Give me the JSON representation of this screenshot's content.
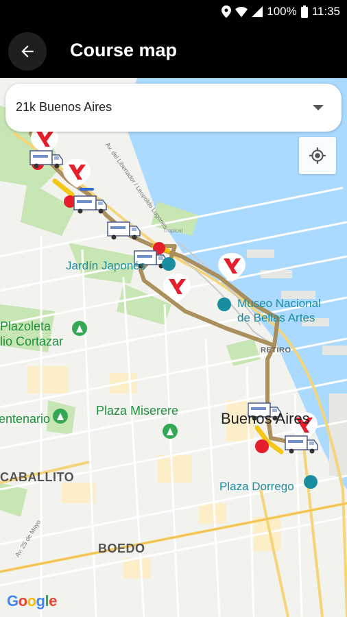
{
  "status_bar": {
    "battery": "100%",
    "time": "11:35"
  },
  "app_bar": {
    "title": "Course map"
  },
  "course_select": {
    "value": "21k Buenos Aires"
  },
  "map": {
    "places": {
      "jardin_japones": "Jardín Japonés",
      "museo": "Museo Nacional\nde Bellas Artes",
      "retiro": "RETIRO",
      "plazoleta": "Plazoleta\nlio Cortazar",
      "centenario": "entenario",
      "plaza_miserere": "Plaza Miserere",
      "buenos_aires": "Buenos Aires",
      "caballito": "CABALLITO",
      "plaza_dorrego": "Plaza Dorrego",
      "boedo": "BOEDO",
      "av_mayo": "Av. 25 de Mayo",
      "leopoldo": "Av. del Libertador / Leopoldo Lugones",
      "tropical": "Tropical"
    },
    "attribution": "Google"
  },
  "icons": {
    "back": "arrow-left-icon",
    "locate": "my-location-icon",
    "marker": "y-logo-marker-icon",
    "truck": "truck-icon"
  },
  "colors": {
    "route": "#a88a55",
    "route_highlight": "#f2c200",
    "marker_red": "#e41e2b",
    "water": "#aadaff",
    "park": "#c8e6b4"
  }
}
